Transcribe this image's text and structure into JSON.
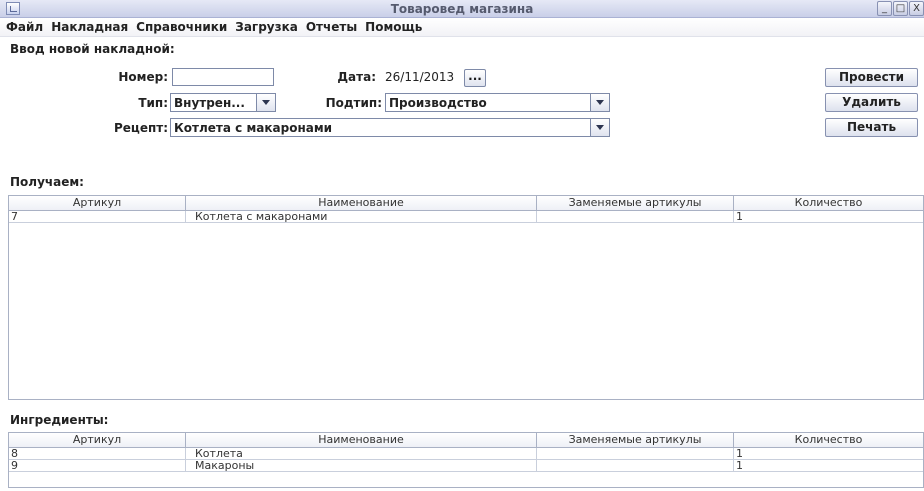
{
  "window": {
    "title": "Товаровед магазина",
    "controls": [
      "_",
      "□",
      "X"
    ]
  },
  "menu": [
    "Файл",
    "Накладная",
    "Справочники",
    "Загрузка",
    "Отчеты",
    "Помощь"
  ],
  "form": {
    "heading": "Ввод новой накладной:",
    "number_label": "Номер:",
    "number_value": "",
    "date_label": "Дата:",
    "date_value": "26/11/2013",
    "date_button": "...",
    "type_label": "Тип:",
    "type_value": "Внутрен...",
    "subtype_label": "Подтип:",
    "subtype_value": "Производство",
    "recipe_label": "Рецепт:",
    "recipe_value": "Котлета с макаронами"
  },
  "actions": {
    "post": "Провести",
    "delete": "Удалить",
    "print": "Печать"
  },
  "receive": {
    "heading": "Получаем:",
    "columns": [
      "Артикул",
      "Наименование",
      "Заменяемые артикулы",
      "Количество"
    ],
    "rows": [
      [
        "7",
        "Котлета с макаронами",
        "",
        "1"
      ]
    ]
  },
  "ingredients": {
    "heading": "Ингредиенты:",
    "columns": [
      "Артикул",
      "Наименование",
      "Заменяемые артикулы",
      "Количество"
    ],
    "rows": [
      [
        "8",
        "Котлета",
        "",
        "1"
      ],
      [
        "9",
        "Макароны",
        "",
        "1"
      ]
    ]
  }
}
